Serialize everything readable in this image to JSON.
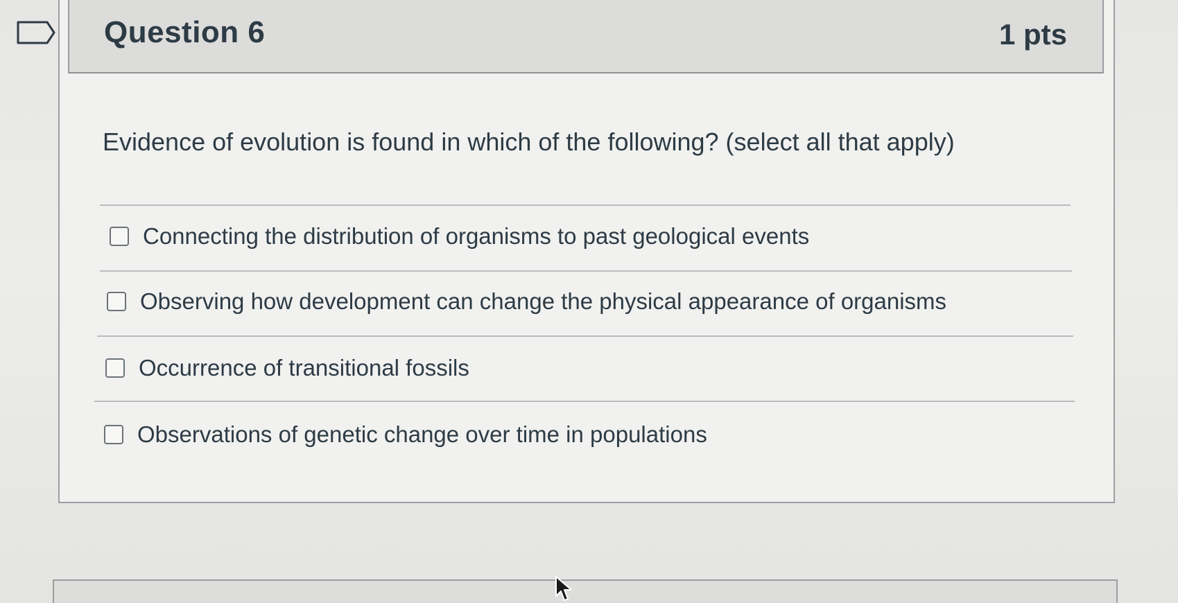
{
  "question": {
    "title": "Question 6",
    "points": "1 pts",
    "text": "Evidence of evolution is found in which of the following? (select all that apply)"
  },
  "answers": [
    {
      "label": "Connecting the distribution of organisms to past geological events",
      "checked": false
    },
    {
      "label": "Observing how development can change the physical appearance of organisms",
      "checked": false
    },
    {
      "label": "Occurrence of transitional fossils",
      "checked": false
    },
    {
      "label": "Observations of genetic change over time in populations",
      "checked": false
    }
  ],
  "icons": {
    "flag": "flag-bookmark-icon",
    "cursor": "mouse-pointer-icon"
  }
}
